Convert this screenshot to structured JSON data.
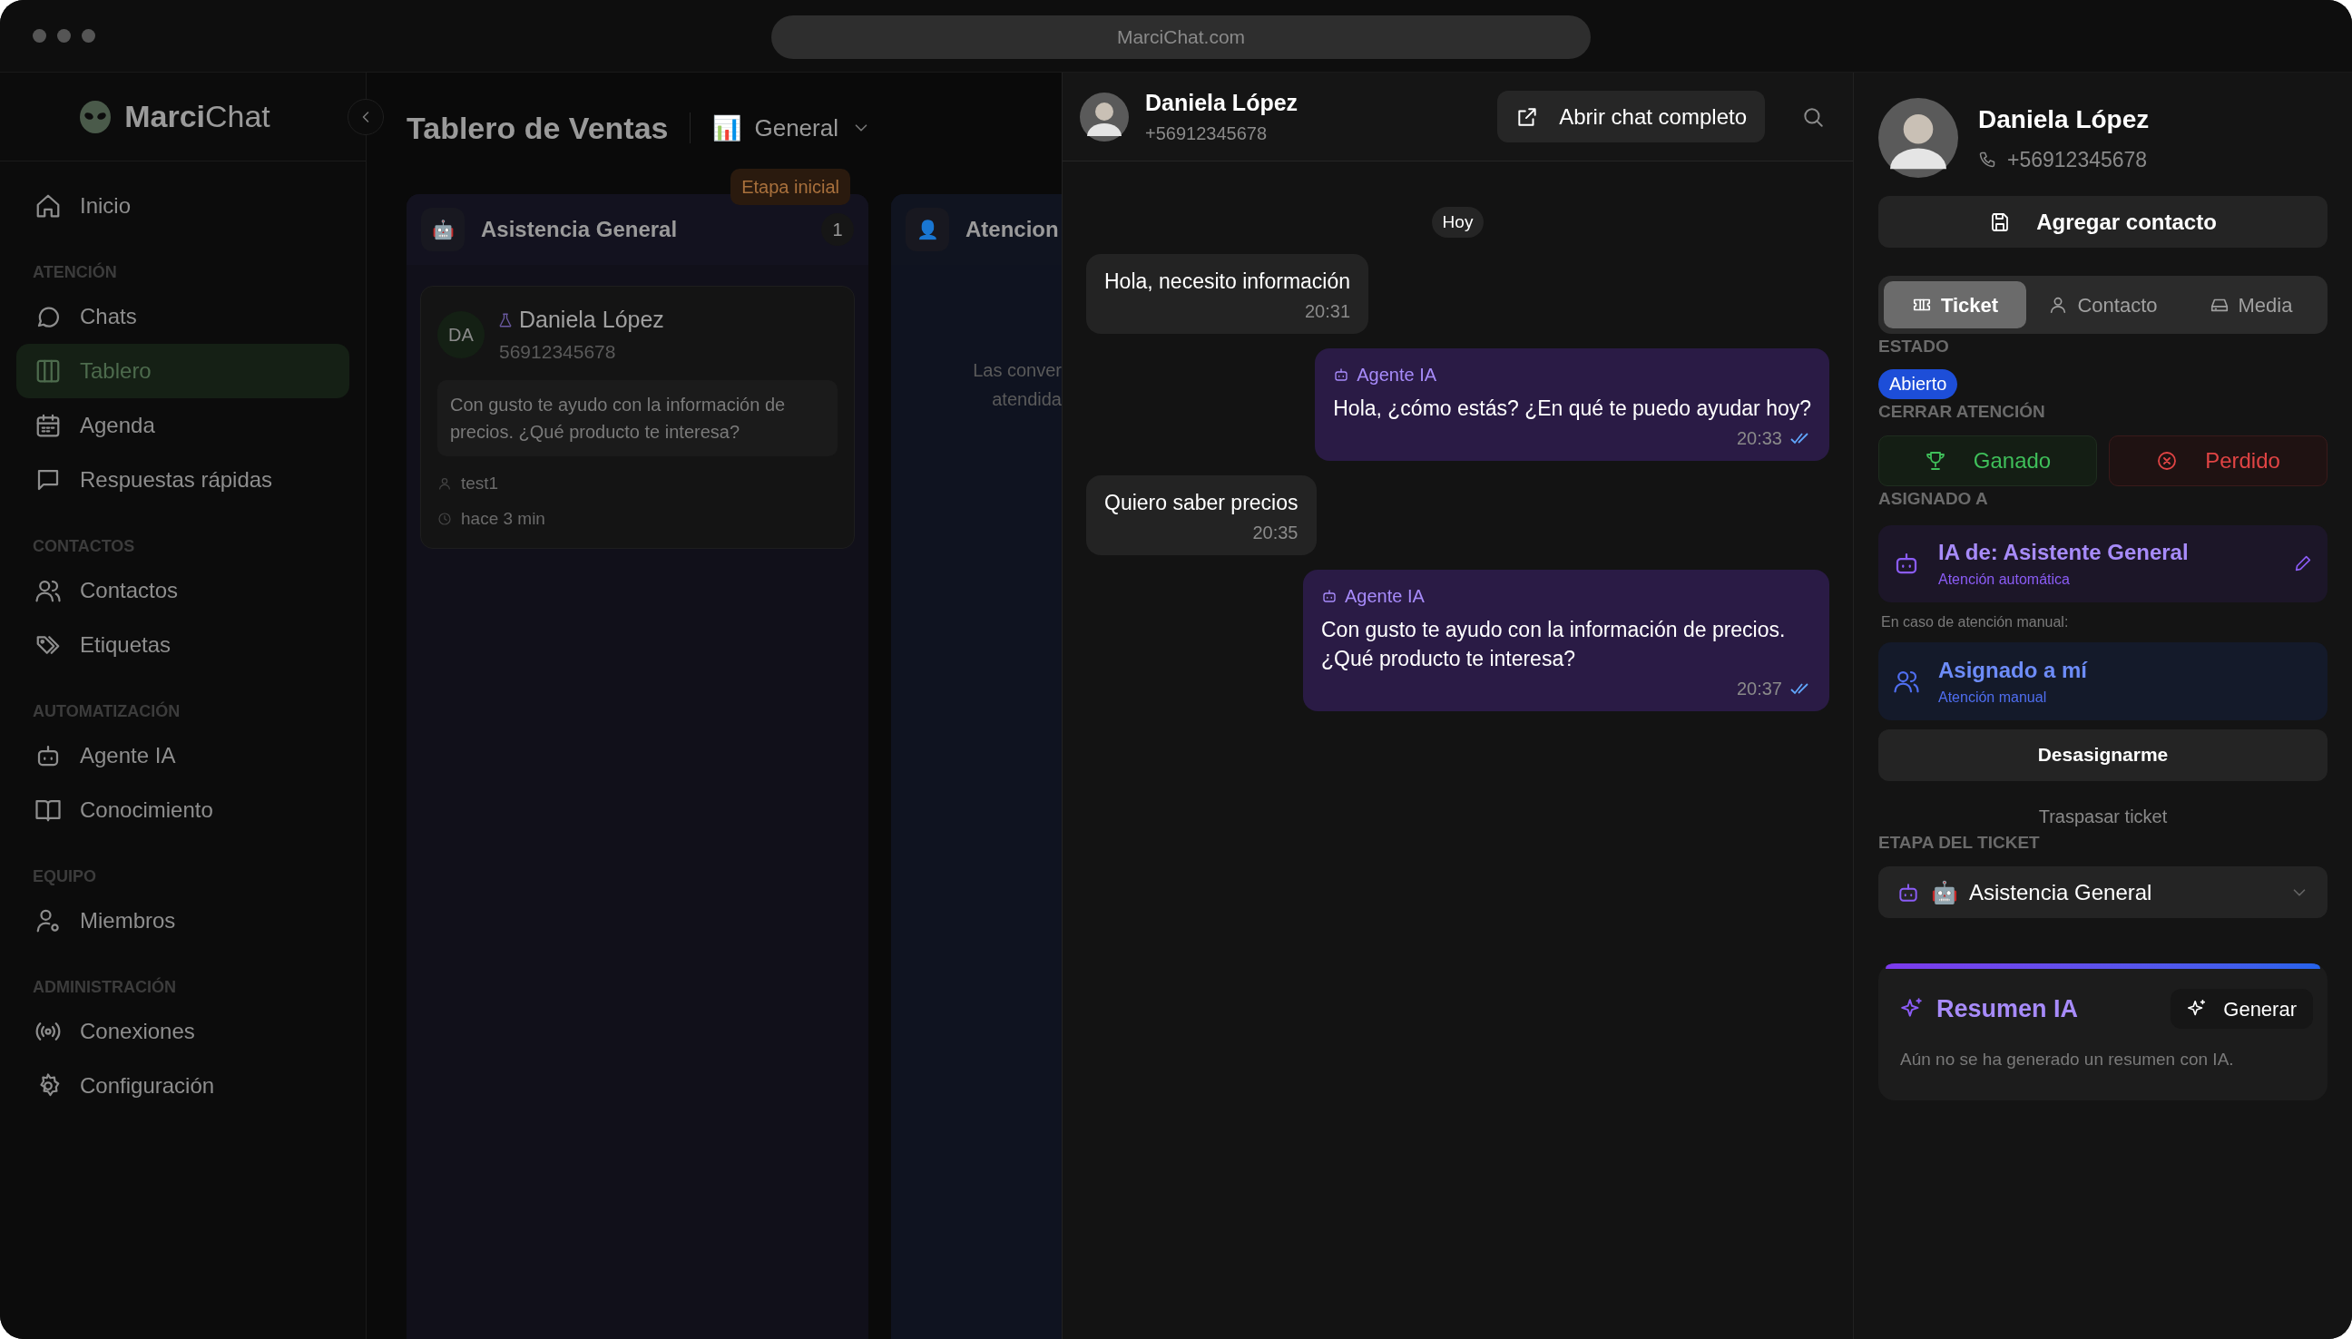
{
  "browser": {
    "url": "MarciChat.com"
  },
  "sidebar": {
    "brand": "**Marci**Chat",
    "items": [
      {
        "kind": "link",
        "label": "Inicio",
        "selected": false
      },
      {
        "kind": "heading",
        "label": "ATENCIÓN"
      },
      {
        "kind": "link",
        "label": "Chats",
        "selected": false
      },
      {
        "kind": "link",
        "label": "Tablero",
        "selected": true
      },
      {
        "kind": "link",
        "label": "Agenda",
        "selected": false
      },
      {
        "kind": "link",
        "label": "Respuestas rápidas",
        "selected": false
      },
      {
        "kind": "heading",
        "label": "CONTACTOS"
      },
      {
        "kind": "link",
        "label": "Contactos",
        "selected": false
      },
      {
        "kind": "link",
        "label": "Etiquetas",
        "selected": false
      },
      {
        "kind": "heading",
        "label": "AUTOMATIZACIÓN"
      },
      {
        "kind": "link",
        "label": "Agente IA",
        "selected": false
      },
      {
        "kind": "link",
        "label": "Conocimiento",
        "selected": false
      },
      {
        "kind": "heading",
        "label": "EQUIPO"
      },
      {
        "kind": "link",
        "label": "Miembros",
        "selected": false
      },
      {
        "kind": "heading",
        "label": "ADMINISTRACIÓN"
      },
      {
        "kind": "link",
        "label": "Conexiones",
        "selected": false
      },
      {
        "kind": "link",
        "label": "Configuración",
        "selected": false
      }
    ]
  },
  "board": {
    "title": "Tablero de Ventas",
    "view": {
      "emoji": "📊",
      "label": "General"
    },
    "columns": [
      {
        "emoji": "🤖",
        "title": "Asistencia General",
        "count": "1",
        "badge": "Etapa inicial",
        "cards": [
          {
            "initials": "DA",
            "name": "Daniela López",
            "phone": "56912345678",
            "preview": "Con gusto te ayudo con la información de precios. ¿Qué producto te interesa?",
            "agent": "test1",
            "time": "hace 3 min"
          }
        ]
      },
      {
        "emoji": "👤",
        "title": "Atencion",
        "empty_text": [
          "Las conver",
          "atendida"
        ]
      }
    ]
  },
  "chat": {
    "name": "Daniela López",
    "phone": "+56912345678",
    "open_button": "Abrir chat completo",
    "day": "Hoy",
    "messages": [
      {
        "kind": "in",
        "text": "Hola, necesito información",
        "time": "20:31"
      },
      {
        "kind": "out",
        "sender": "Agente IA",
        "text": "Hola, ¿cómo estás? ¿En qué te puedo ayudar hoy?",
        "time": "20:33",
        "read": true
      },
      {
        "kind": "in",
        "text": "Quiero saber precios",
        "time": "20:35"
      },
      {
        "kind": "out",
        "sender": "Agente IA",
        "text": "Con gusto te ayudo con la información de precios. ¿Qué producto te interesa?",
        "time": "20:37",
        "read": true
      }
    ]
  },
  "details": {
    "name": "Daniela López",
    "phone": "+56912345678",
    "add_button": "Agregar contacto",
    "tabs": [
      {
        "label": "Ticket",
        "selected": true
      },
      {
        "label": "Contacto",
        "selected": false
      },
      {
        "label": "Media",
        "selected": false
      }
    ],
    "status_label": "ESTADO",
    "status": "Abierto",
    "close_label": "CERRAR ATENCIÓN",
    "won_button": "Ganado",
    "lost_button": "Perdido",
    "assigned_label": "ASIGNADO A",
    "ai_assignee": {
      "title": "IA de: Asistente General",
      "subtitle": "Atención automática"
    },
    "manual_note": "En caso de atención manual:",
    "manual_assignee": {
      "title": "Asignado a mí",
      "subtitle": "Atención manual"
    },
    "unassign_button": "Desasignarme",
    "transfer_link": "Traspasar ticket",
    "stage_label": "ETAPA DEL TICKET",
    "stage": {
      "emoji": "🤖",
      "label": "Asistencia General"
    },
    "summary": {
      "title": "Resumen IA",
      "button": "Generar",
      "text": "Aún no se ha generado un resumen con IA."
    }
  }
}
